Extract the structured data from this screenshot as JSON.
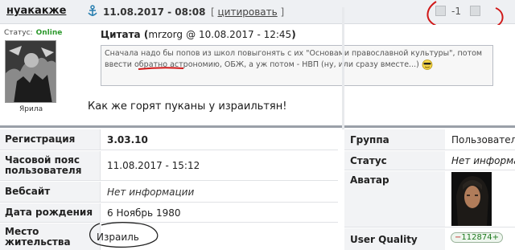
{
  "post": {
    "username": "нуакакже",
    "date": "11.08.2017 - 08:08",
    "quote_link_label": "цитировать",
    "rating": "-1",
    "status_label": "Статус:",
    "status_value": "Online",
    "avatar_caption": "Ярила",
    "quote": {
      "title": "Цитата",
      "nick": "mrzorg",
      "date": "@ 10.08.2017 - 12:45",
      "text": "Сначала надо бы попов из школ повыгонять с их \"Основами православной культуры\", потом ввести обратно астрономию, ОБЖ, а уж потом - НВП (ну, или сразу вместе...)"
    },
    "text": "Как же горят пуканы у израильтян!"
  },
  "profile": {
    "left": [
      {
        "key": "Регистрация",
        "value": "3.03.10"
      },
      {
        "key": "Часовой пояс пользователя",
        "value": "11.08.2017 - 15:12"
      },
      {
        "key": "Вебсайт",
        "value": "Нет информации"
      },
      {
        "key": "Дата рождения",
        "value": "6 Ноябрь 1980"
      },
      {
        "key": "Место жительства",
        "value": "Израиль"
      }
    ],
    "right": [
      {
        "key": "Группа",
        "value": "Пользовател"
      },
      {
        "key": "Статус",
        "value": "Нет информа"
      },
      {
        "key": "Аватар",
        "value": ""
      },
      {
        "key": "User Quality",
        "value": "112874"
      }
    ]
  },
  "colors": {
    "online": "#2e9a2e",
    "annotation": "#d01818",
    "quality": "#1e7a1e"
  },
  "icons": {
    "anchor": "anchor-icon",
    "smiley": "cool-smiley-icon",
    "rate_minus": "rate-minus-icon",
    "rate_plus": "rate-plus-icon"
  }
}
